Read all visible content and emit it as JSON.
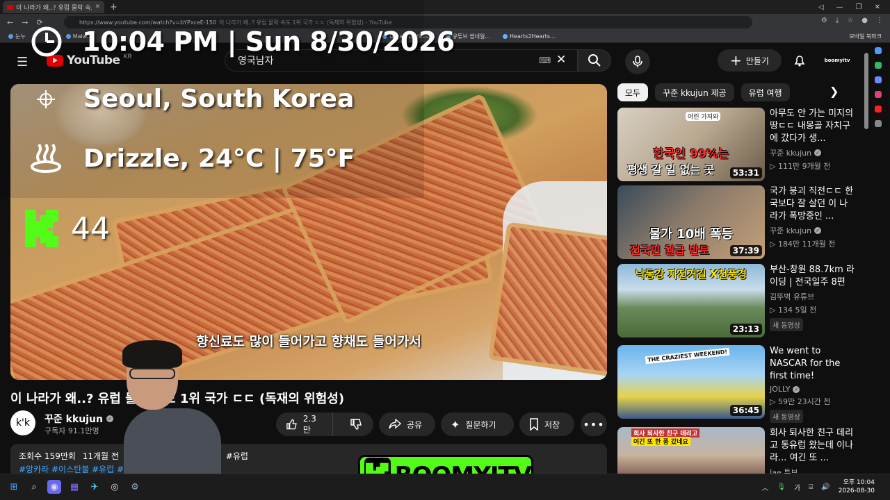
{
  "browser": {
    "tab_title": "이 나라가 왜..? 유럽 물락 속도 1",
    "new_tab": "+",
    "url": "https://www.youtube.com/watch?v=bYPxceE-150",
    "url_title": "이 나라가 왜..? 유럽 물락 속도 1위 국가 ㄷㄷ (독재의 위험성) - YouTube",
    "bookmarks": [
      "눈누",
      "Malw...",
      "Urban Diction...",
      "유튜브 썸네일...",
      "Hearts2Hearts..."
    ],
    "bookmark_folder": "모바일 북마크"
  },
  "header": {
    "logo_word": "YouTube",
    "logo_country": "KR",
    "search_value": "영국남자",
    "create_label": "만들기",
    "account_label": "boomyitv"
  },
  "overlay": {
    "clock": "10:04 PM | Sun 8/30/2026",
    "location": "Seoul, South Korea",
    "weather": "Drizzle, 24°C | 75°F",
    "viewer_count": "44"
  },
  "player": {
    "subtitle": "향신료도 많이 들어가고 향채도 들어가서"
  },
  "video": {
    "title": "이 나라가 왜..? 유럽 물락 속도 1위 국가 ㄷㄷ (독재의 위험성)",
    "channel": "꾸준 kkujun",
    "subscribers": "구독자 91.1만명",
    "avatar_text": "k'k",
    "likes": "2.3만",
    "share_label": "공유",
    "ask_label": "질문하기",
    "save_label": "저장",
    "views": "조회수 159만회",
    "date": "11개월 전",
    "desc_hashtags_inline": "#유럽",
    "hashtags": "#앙카라 #이스탄불 #유럽 #터키 #튀르키예 #여행"
  },
  "chips": [
    "모두",
    "꾸준 kkujun 제공",
    "유럽 여행"
  ],
  "recommendations": [
    {
      "title": "아무도 안 가는 미지의 땅ㄷㄷ 내몽골 자치구에 갔다가 생...",
      "channel": "꾸준 kkujun",
      "meta": "▷ 111만 9개월 전",
      "duration": "53:31",
      "thumb_caption1": "한국인 99%는",
      "thumb_caption2": "평생 갈 일 없는 곳",
      "thumb_tag": "어린 가져와"
    },
    {
      "title": "국가 붕괴 직전ㄷㄷ 한국보다 잘 살던 이 나라가 폭망중인 ...",
      "channel": "꾸준 kkujun",
      "meta": "▷ 184만 11개월 전",
      "duration": "37:39",
      "thumb_caption1": "물가 10배 폭등",
      "thumb_caption2": "전국민 월급 반토"
    },
    {
      "title": "부산-창원 88.7km 라이딩 | 전국일주 8편",
      "channel": "김뚜벅 유튜브",
      "meta": "▷ 134 5일 전",
      "badge": "새 동영상",
      "duration": "23:13",
      "thumb_caption1": "낙동강 자전거길 X천풍경"
    },
    {
      "title": "We went to NASCAR for the first time!",
      "channel": "JOLLY",
      "meta": "▷ 59만 23시간 전",
      "badge": "새 동영상",
      "duration": "36:45",
      "thumb_caption1": "THE CRAZIEST WEEKEND!"
    },
    {
      "title": "회사 퇴사한 친구 데리고 동유럽 왔는데 이나라... 여긴 또 ...",
      "channel": "Jae 튜브",
      "meta": "",
      "duration": "",
      "thumb_caption1": "회사 퇴사한 친구 데리고",
      "thumb_caption2": "여긴 또 한 풍 갔네요"
    }
  ],
  "brand": {
    "text": "BOOMYITV"
  },
  "taskbar": {
    "tray_ime": "가",
    "time": "오후 10:04",
    "date": "2026-08-30"
  }
}
